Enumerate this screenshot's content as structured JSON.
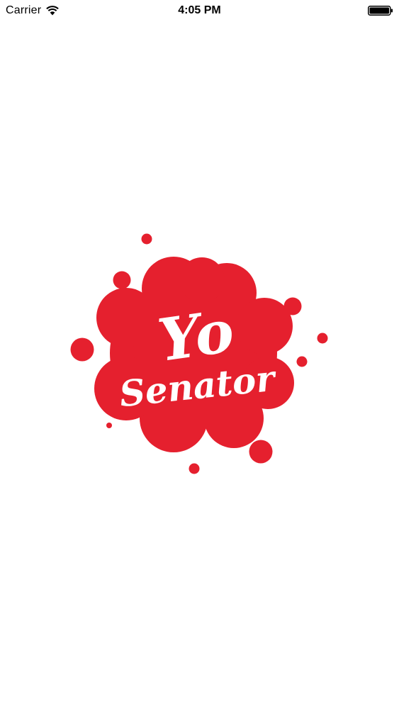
{
  "status_bar": {
    "carrier": "Carrier",
    "time": "4:05 PM",
    "wifi_icon": "wifi-icon",
    "battery_icon": "battery-icon"
  },
  "logo": {
    "line1": "Yo",
    "line2": "Senator",
    "brand_color": "#E5202E",
    "text_color": "#FFFFFF"
  }
}
